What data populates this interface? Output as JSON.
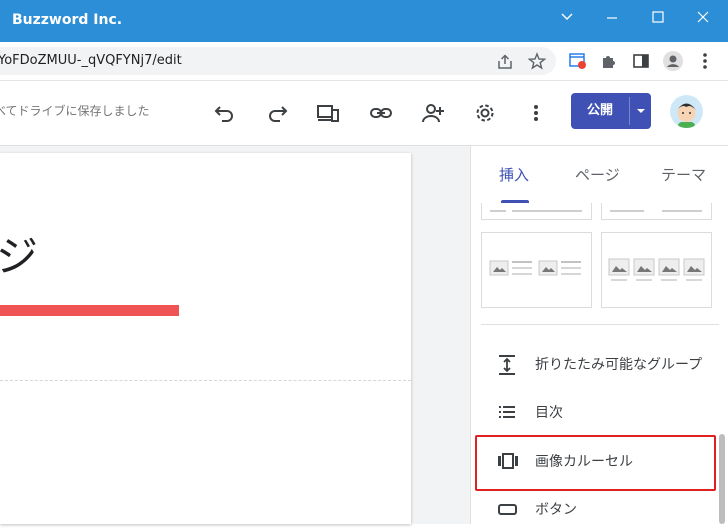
{
  "window": {
    "title": "Buzzword Inc.",
    "controls": [
      "chevron-down-icon",
      "minimize-icon",
      "maximize-icon",
      "close-icon"
    ]
  },
  "browser": {
    "url": "YoFDoZMUU-_qVQFYNj7/edit",
    "actions": [
      "share-icon",
      "star-icon",
      "extension-alert-icon",
      "puzzle-icon",
      "side-panel-icon",
      "profile-icon",
      "more-vert-icon"
    ]
  },
  "toolbar": {
    "save_status": "べてドライブに保存しました",
    "actions": [
      "undo-icon",
      "redo-icon",
      "preview-devices-icon",
      "link-icon",
      "add-person-icon",
      "settings-icon",
      "more-vert-icon"
    ],
    "publish_label": "公開",
    "accent": "#3f51b5"
  },
  "canvas": {
    "heading": "ジ",
    "accent_bar_color": "#f05353"
  },
  "panel": {
    "tabs": [
      {
        "label": "挿入",
        "active": true
      },
      {
        "label": "ページ",
        "active": false
      },
      {
        "label": "テーマ",
        "active": false
      }
    ],
    "items": [
      {
        "label": "折りたたみ可能なグループ",
        "icon": "collapsible-group-icon"
      },
      {
        "label": "目次",
        "icon": "table-of-contents-icon"
      },
      {
        "label": "画像カルーセル",
        "icon": "carousel-icon",
        "selected": true
      },
      {
        "label": "ボタン",
        "icon": "button-icon"
      }
    ],
    "selection_color": "#e02020"
  }
}
